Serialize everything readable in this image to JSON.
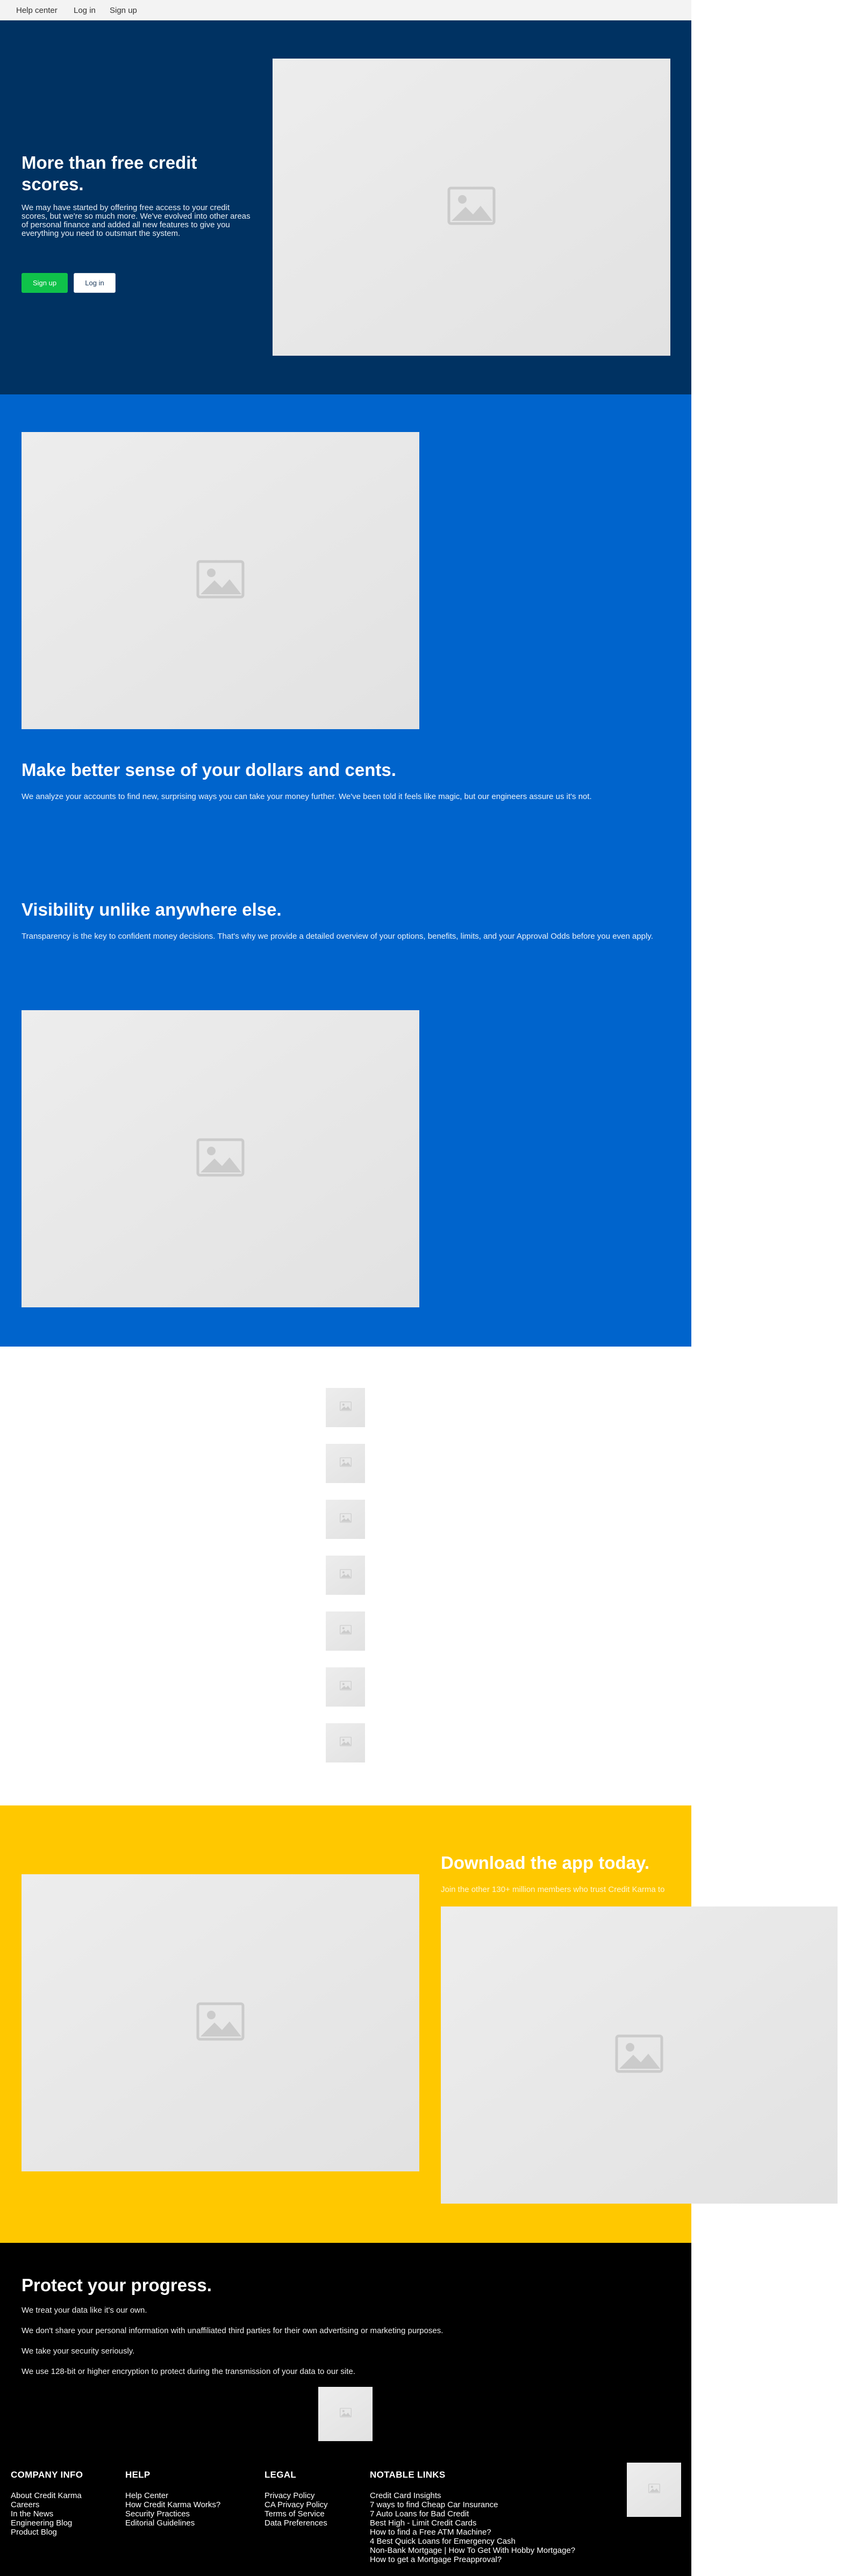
{
  "topnav": {
    "links": [
      "Help center",
      "Log in",
      "Sign up"
    ]
  },
  "hero": {
    "title": "More than free credit scores.",
    "body": "We may have started by offering free access to your credit scores, but we're so much more. We've evolved into other areas of personal finance and added all new features to give you everything you need to outsmart the system.",
    "signup_label": "Sign up",
    "login_label": "Log in"
  },
  "blue": {
    "section1_title": "Make better sense of your dollars and cents.",
    "section1_body": "We analyze your accounts to find new, surprising ways you can take your money further. We've been told it feels like magic, but our engineers assure us it's not.",
    "section2_title": "Visibility unlike anywhere else.",
    "section2_body": "Transparency is the key to confident money decisions. That's why we provide a detailed overview of your options, benefits, limits, and your Approval Odds before you even apply."
  },
  "app": {
    "title": "Download the app today.",
    "subtitle": "Join the other 130+ million members who trust Credit Karma to"
  },
  "security": {
    "title": "Protect your progress.",
    "lines": [
      "We treat your data like it's our own.",
      "We don't share your personal information with unaffiliated third parties for their own advertising or marketing purposes.",
      "We take your security seriously.",
      "We use 128-bit or higher encryption to protect during the transmission of your data to our site."
    ]
  },
  "footer": {
    "company": {
      "heading": "COMPANY INFO",
      "links": [
        "About Credit Karma",
        "Careers",
        "In the News",
        "Engineering Blog",
        "Product Blog"
      ]
    },
    "help": {
      "heading": "HELP",
      "links": [
        "Help Center",
        "How Credit Karma Works?",
        "Security Practices",
        "Editorial Guidelines"
      ]
    },
    "legal": {
      "heading": "LEGAL",
      "links": [
        "Privacy Policy",
        "CA Privacy Policy",
        "Terms of Service",
        "Data Preferences"
      ]
    },
    "notable": {
      "heading": "NOTABLE LINKS",
      "links": [
        "Credit Card Insights",
        "7 ways to find Cheap Car Insurance",
        "7 Auto Loans for Bad Credit",
        "Best High - Limit Credit Cards",
        "How to find a Free ATM Machine?",
        "4 Best Quick Loans for Emergency Cash",
        "Non-Bank Mortgage | How To Get With Hobby Mortgage?",
        "How to get a Mortgage Preapproval?"
      ]
    }
  },
  "colors": {
    "hero_bg": "#003262",
    "blue_bg": "#0064cc",
    "yellow_bg": "#ffc800",
    "signup_green": "#0fc24a"
  }
}
